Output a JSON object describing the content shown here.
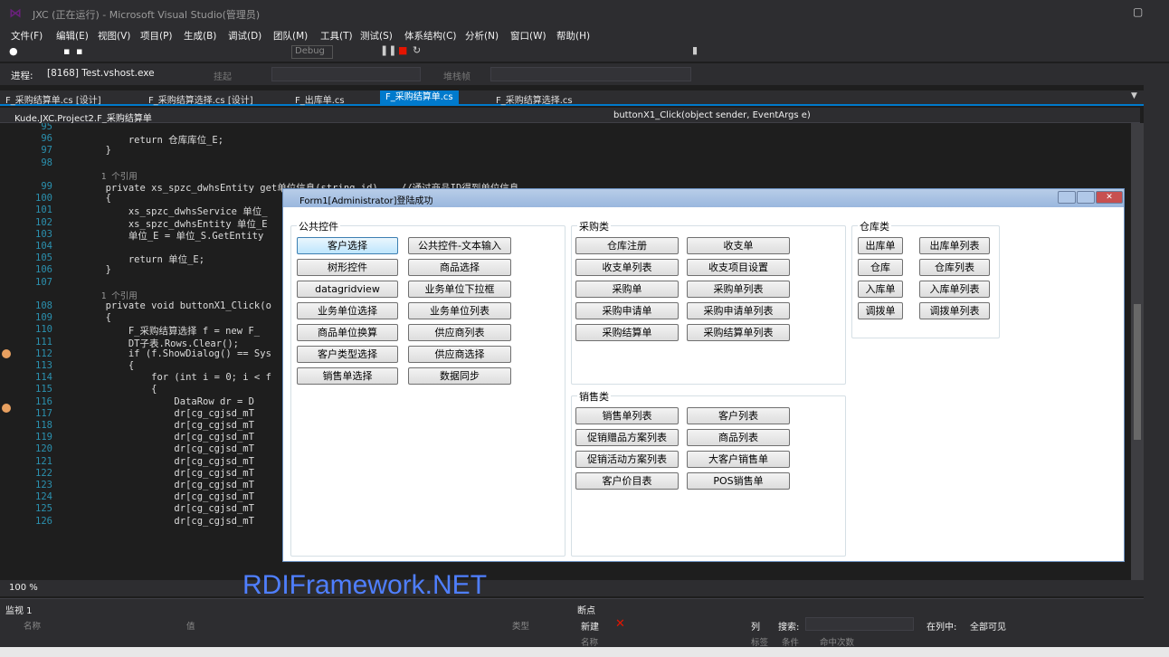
{
  "window": {
    "title": "JXC (正在运行) - Microsoft Visual Studio(管理员)"
  },
  "menu": [
    "文件(F)",
    "编辑(E)",
    "视图(V)",
    "项目(P)",
    "生成(B)",
    "调试(D)",
    "团队(M)",
    "工具(T)",
    "测试(S)",
    "体系结构(C)",
    "分析(N)",
    "窗口(W)",
    "帮助(H)"
  ],
  "toolbar": {
    "config": "Debug"
  },
  "process": {
    "label": "进程:",
    "value": "[8168] Test.vshost.exe",
    "thread_label": "挂起",
    "stack_label": "堆栈帧"
  },
  "tabs": [
    {
      "label": "F_采购结算单.cs [设计]"
    },
    {
      "label": "F_采购结算选择.cs [设计]"
    },
    {
      "label": "F_出库单.cs"
    },
    {
      "label": "F_采购结算单.cs"
    },
    {
      "label": "F_采购结算选择.cs"
    }
  ],
  "nav": {
    "class": "Kude.JXC.Project2.F_采购结算单",
    "method": "buttonX1_Click(object sender, EventArgs e)"
  },
  "code": [
    {
      "n": "95",
      "text": ""
    },
    {
      "n": "96",
      "text": "            return 仓库库位_E;"
    },
    {
      "n": "97",
      "text": "        }"
    },
    {
      "n": "98",
      "text": ""
    },
    {
      "n": "",
      "text": "        1 个引用"
    },
    {
      "n": "99",
      "text": "        private xs_spzc_dwhsEntity get单位信息(string id)    //通过商品ID得到单位信息"
    },
    {
      "n": "100",
      "text": "        {"
    },
    {
      "n": "101",
      "text": "            xs_spzc_dwhsService 单位_"
    },
    {
      "n": "102",
      "text": "            xs_spzc_dwhsEntity 单位_E"
    },
    {
      "n": "103",
      "text": "            单位_E = 单位_S.GetEntity"
    },
    {
      "n": "104",
      "text": ""
    },
    {
      "n": "105",
      "text": "            return 单位_E;"
    },
    {
      "n": "106",
      "text": "        }"
    },
    {
      "n": "107",
      "text": ""
    },
    {
      "n": "",
      "text": "        1 个引用"
    },
    {
      "n": "108",
      "text": "        private void buttonX1_Click(o"
    },
    {
      "n": "109",
      "text": "        {"
    },
    {
      "n": "110",
      "text": "            F_采购结算选择 f = new F_"
    },
    {
      "n": "111",
      "text": "            DT子表.Rows.Clear();"
    },
    {
      "n": "112",
      "text": "            if (f.ShowDialog() == Sys"
    },
    {
      "n": "113",
      "text": "            {"
    },
    {
      "n": "114",
      "text": "                for (int i = 0; i < f"
    },
    {
      "n": "115",
      "text": "                {"
    },
    {
      "n": "116",
      "text": "                    DataRow dr = D"
    },
    {
      "n": "117",
      "text": "                    dr[cg_cgjsd_mT"
    },
    {
      "n": "118",
      "text": "                    dr[cg_cgjsd_mT"
    },
    {
      "n": "119",
      "text": "                    dr[cg_cgjsd_mT"
    },
    {
      "n": "120",
      "text": "                    dr[cg_cgjsd_mT"
    },
    {
      "n": "121",
      "text": "                    dr[cg_cgjsd_mT"
    },
    {
      "n": "122",
      "text": "                    dr[cg_cgjsd_mT"
    },
    {
      "n": "123",
      "text": "                    dr[cg_cgjsd_mT"
    },
    {
      "n": "124",
      "text": "                    dr[cg_cgjsd_mT"
    },
    {
      "n": "125",
      "text": "                    dr[cg_cgjsd_mT"
    },
    {
      "n": "126",
      "text": "                    dr[cg_cgjsd_mT"
    }
  ],
  "zoom": "100 %",
  "form": {
    "title": "Form1[Administrator]登陆成功",
    "groups": {
      "common": {
        "label": "公共控件",
        "buttons": [
          "客户选择",
          "公共控件-文本输入",
          "树形控件",
          "商品选择",
          "datagridview",
          "业务单位下拉框",
          "业务单位选择",
          "业务单位列表",
          "商品单位换算",
          "供应商列表",
          "客户类型选择",
          "供应商选择",
          "销售单选择",
          "数据同步"
        ]
      },
      "purchase": {
        "label": "采购类",
        "buttons": [
          "仓库注册",
          "收支单",
          "收支单列表",
          "收支项目设置",
          "采购单",
          "采购单列表",
          "采购申请单",
          "采购申请单列表",
          "采购结算单",
          "采购结算单列表"
        ]
      },
      "warehouse": {
        "label": "仓库类",
        "buttons": [
          "出库单",
          "出库单列表",
          "仓库",
          "仓库列表",
          "入库单",
          "入库单列表",
          "调拨单",
          "调拨单列表"
        ]
      },
      "sales": {
        "label": "销售类",
        "buttons": [
          "销售单列表",
          "客户列表",
          "促销赠品方案列表",
          "商品列表",
          "促销活动方案列表",
          "大客户销售单",
          "客户价目表",
          "POS销售单"
        ]
      }
    }
  },
  "watermark": "RDIFramework.NET",
  "watch": {
    "title": "监视 1",
    "col_name": "名称",
    "col_value": "值",
    "col_type": "类型"
  },
  "breakpoints": {
    "title": "断点",
    "new": "新建",
    "columns": "列",
    "search": "搜索:",
    "in_column": "在列中:",
    "all_visible": "全部可见",
    "col_name": "名称",
    "col_label": "标签",
    "col_cond": "条件",
    "col_hit": "命中次数"
  }
}
